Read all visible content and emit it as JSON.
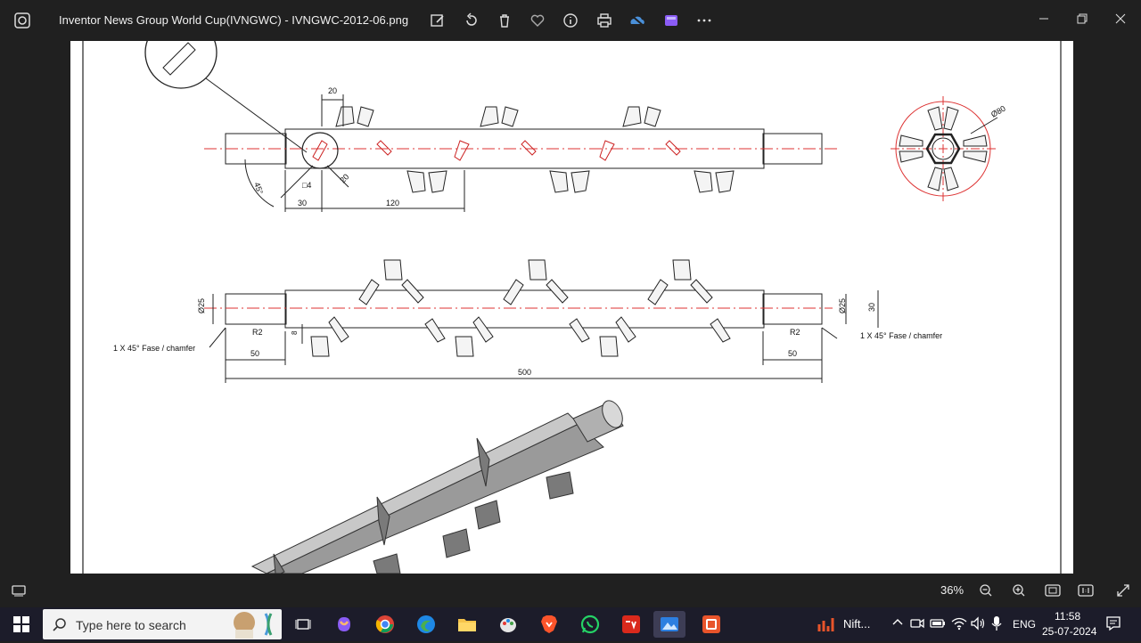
{
  "window": {
    "title": "Inventor News Group World Cup(IVNGWC) - IVNGWC-2012-06.png",
    "toolbar_icons": [
      "edit-image-icon",
      "rotate-icon",
      "delete-icon",
      "favorite-icon",
      "info-icon",
      "print-icon",
      "onedrive-icon",
      "editor-icon",
      "more-icon"
    ],
    "buttons": {
      "minimize": "minimize",
      "restore": "restore",
      "close": "close"
    }
  },
  "drawing": {
    "dims_top": {
      "d20a": "20",
      "d45": "45°",
      "sq4": "□4",
      "d20b": "20",
      "d30": "30",
      "d120": "120",
      "d80": "Ø80"
    },
    "dims_mid": {
      "d25_left": "Ø25",
      "r2_left": "R2",
      "chamfer_left": "1 X 45° Fase / chamfer",
      "d8": "8",
      "d50_left": "50",
      "d500": "500",
      "d25_right": "Ø25",
      "d30_right": "30",
      "r2_right": "R2",
      "chamfer_right": "1 X 45° Fase / chamfer",
      "d50_right": "50"
    }
  },
  "status": {
    "zoom": "36%"
  },
  "taskbar": {
    "search_placeholder": "Type here to search",
    "tray_app": "Nift...",
    "lang": "ENG",
    "time": "11:58",
    "date": "25-07-2024"
  }
}
